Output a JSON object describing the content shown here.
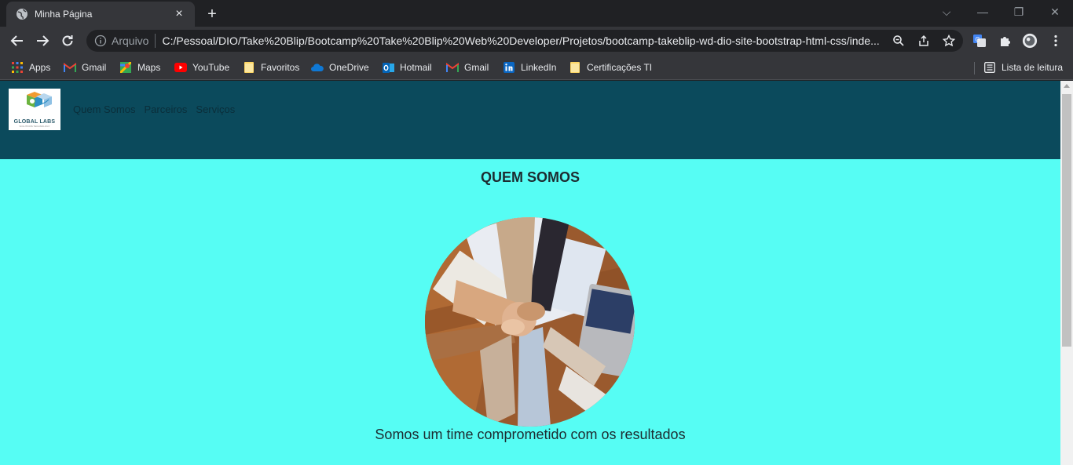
{
  "tab": {
    "title": "Minha Página",
    "close": "×",
    "new_tab": "+"
  },
  "window_controls": {
    "dropdown": "⌵",
    "minimize": "—",
    "restore": "❐",
    "close": "✕"
  },
  "omnibox": {
    "scheme": "Arquivo",
    "url": "C:/Pessoal/DIO/Take%20Blip/Bootcamp%20Take%20Blip%20Web%20Developer/Projetos/bootcamp-takeblip-wd-dio-site-bootstrap-html-css/inde..."
  },
  "bookmarks": [
    {
      "label": "Apps",
      "icon": "apps-grid-icon"
    },
    {
      "label": "Gmail",
      "icon": "gmail-icon"
    },
    {
      "label": "Maps",
      "icon": "maps-icon"
    },
    {
      "label": "YouTube",
      "icon": "youtube-icon"
    },
    {
      "label": "Favoritos",
      "icon": "folder-icon"
    },
    {
      "label": "OneDrive",
      "icon": "onedrive-icon"
    },
    {
      "label": "Hotmail",
      "icon": "outlook-icon"
    },
    {
      "label": "Gmail",
      "icon": "gmail-icon"
    },
    {
      "label": "LinkedIn",
      "icon": "linkedin-icon"
    },
    {
      "label": "Certificações TI",
      "icon": "folder-icon"
    }
  ],
  "reading_list": {
    "label": "Lista de leitura",
    "icon": "reading-list-icon"
  },
  "site": {
    "logo": {
      "text": "GLOBAL LABS",
      "subtext": "SOLUTIONS TECHNOLOGY"
    },
    "nav": [
      "Quem Somos",
      "Parceiros",
      "Serviços"
    ],
    "section_title": "QUEM SOMOS",
    "tagline": "Somos um time comprometido com os resultados"
  },
  "colors": {
    "header_bg": "#0b4a5c",
    "page_bg": "#56fdf4",
    "chrome_dark": "#202124",
    "chrome_toolbar": "#35363a"
  }
}
